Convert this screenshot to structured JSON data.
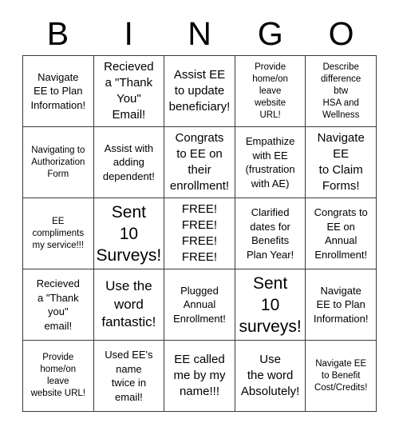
{
  "card": {
    "title": "BINGO",
    "headers": [
      "B",
      "I",
      "N",
      "G",
      "O"
    ],
    "grid_size": 5,
    "colors": {
      "background": "#ffffff",
      "border": "#3a3a3a",
      "text": "#000000"
    },
    "rows": [
      [
        {
          "text": "Navigate\nEE to Plan\nInformation!",
          "size": "sm"
        },
        {
          "text": "Recieved\na \"Thank\nYou\"\nEmail!",
          "size": "md"
        },
        {
          "text": "Assist EE\nto update\nbeneficiary!",
          "size": "md"
        },
        {
          "text": "Provide\nhome/on\nleave\nwebsite\nURL!",
          "size": "xs"
        },
        {
          "text": "Describe\ndifference\nbtw\nHSA and\nWellness",
          "size": "xs"
        }
      ],
      [
        {
          "text": "Navigating to\nAuthorization\nForm",
          "size": "xs"
        },
        {
          "text": "Assist with\nadding\ndependent!",
          "size": "sm"
        },
        {
          "text": "Congrats\nto EE on\ntheir\nenrollment!",
          "size": "md"
        },
        {
          "text": "Empathize\nwith EE\n(frustration\nwith AE)",
          "size": "sm"
        },
        {
          "text": "Navigate\nEE\nto Claim\nForms!",
          "size": "md"
        }
      ],
      [
        {
          "text": "EE\ncompliments\nmy service!!!",
          "size": "xs"
        },
        {
          "text": "Sent\n10\nSurveys!",
          "size": "xl"
        },
        {
          "text": "FREE!\nFREE!\nFREE!\nFREE!",
          "size": "md"
        },
        {
          "text": "Clarified\ndates for\nBenefits\nPlan Year!",
          "size": "sm"
        },
        {
          "text": "Congrats to\nEE on\nAnnual\nEnrollment!",
          "size": "sm"
        }
      ],
      [
        {
          "text": "Recieved\na \"Thank\nyou\"\nemail!",
          "size": "sm"
        },
        {
          "text": "Use the\nword\nfantastic!",
          "size": "lg"
        },
        {
          "text": "Plugged\nAnnual\nEnrollment!",
          "size": "sm"
        },
        {
          "text": "Sent\n10\nsurveys!",
          "size": "xl"
        },
        {
          "text": "Navigate\nEE to Plan\nInformation!",
          "size": "sm"
        }
      ],
      [
        {
          "text": "Provide\nhome/on\nleave\nwebsite URL!",
          "size": "xs"
        },
        {
          "text": "Used EE's\nname\ntwice in\nemail!",
          "size": "sm"
        },
        {
          "text": "EE called\nme by my\nname!!!",
          "size": "md"
        },
        {
          "text": "Use\nthe word\nAbsolutely!",
          "size": "md"
        },
        {
          "text": "Navigate EE\nto Benefit\nCost/Credits!",
          "size": "xs"
        }
      ]
    ]
  }
}
